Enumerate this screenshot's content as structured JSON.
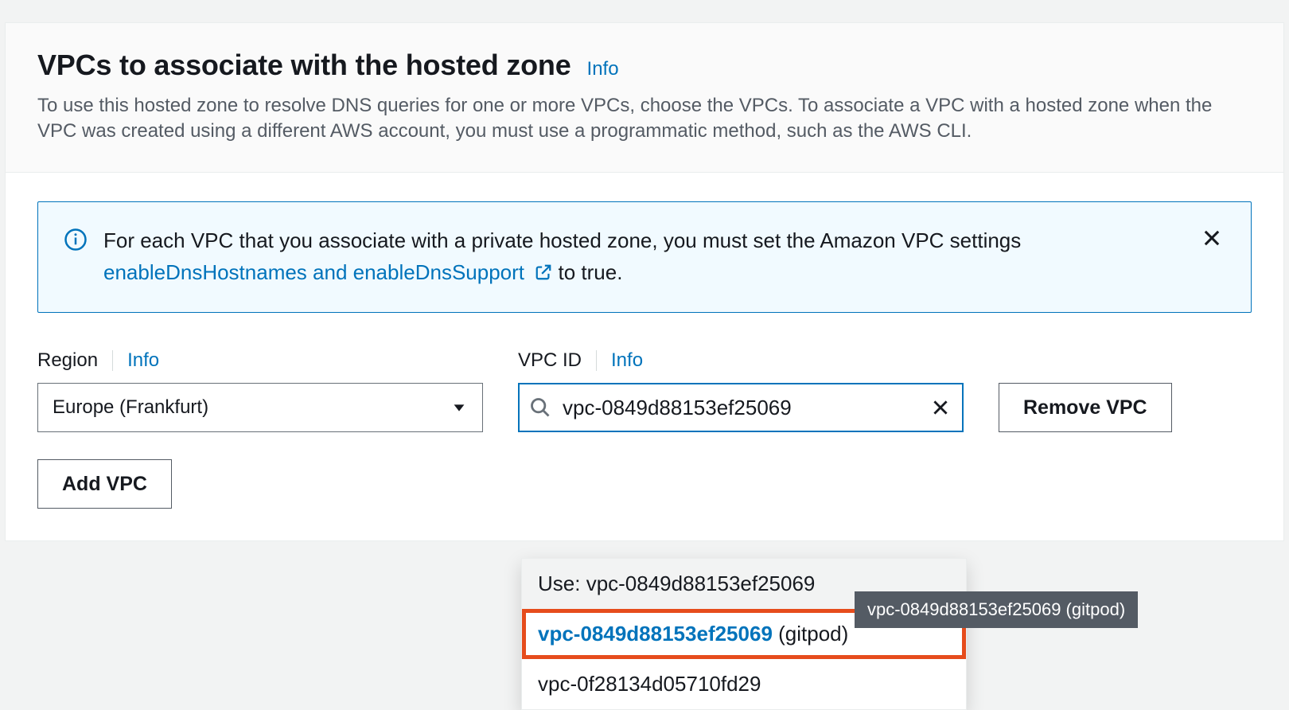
{
  "header": {
    "title": "VPCs to associate with the hosted zone",
    "info": "Info",
    "description": "To use this hosted zone to resolve DNS queries for one or more VPCs, choose the VPCs. To associate a VPC with a hosted zone when the VPC was created using a different AWS account, you must use a programmatic method, such as the AWS CLI."
  },
  "alert": {
    "prefix": "For each VPC that you associate with a private hosted zone, you must set the Amazon VPC settings ",
    "link_text": "enableDnsHostnames and enableDnsSupport",
    "suffix": " to true."
  },
  "fields": {
    "region": {
      "label": "Region",
      "info": "Info",
      "value": "Europe (Frankfurt)"
    },
    "vpc": {
      "label": "VPC ID",
      "info": "Info",
      "value": "vpc-0849d88153ef25069"
    }
  },
  "buttons": {
    "remove": "Remove VPC",
    "add": "Add VPC"
  },
  "dropdown": {
    "use_prefix": "Use: ",
    "use_value": "vpc-0849d88153ef25069",
    "highlighted_id": "vpc-0849d88153ef25069",
    "highlighted_suffix": " (gitpod)",
    "other": "vpc-0f28134d05710fd29"
  },
  "tooltip": "vpc-0849d88153ef25069 (gitpod)"
}
